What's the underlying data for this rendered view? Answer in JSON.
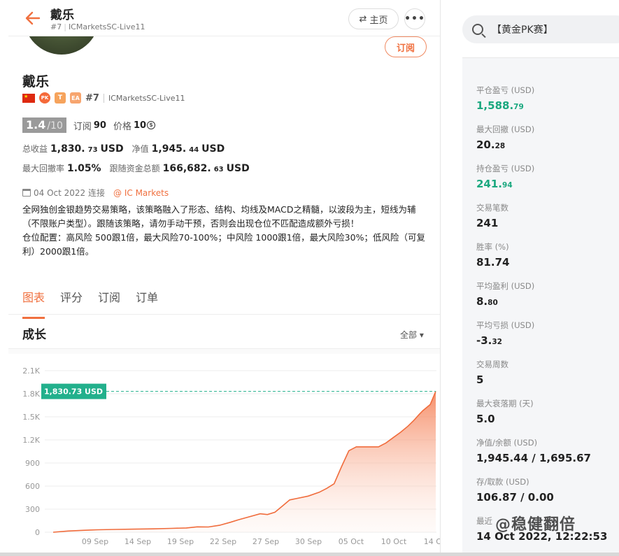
{
  "header": {
    "name": "戴乐",
    "rank": "#7",
    "broker": "ICMarketsSC-Live11",
    "home_label": "主页",
    "more_label": "•••"
  },
  "profile": {
    "name": "戴乐",
    "subscribe_label": "订阅",
    "pk_label": "PK",
    "t_label": "T",
    "ea_label": "EA",
    "rank": "#7",
    "broker": "ICMarketsSC-Live11",
    "score": "1.4",
    "score_total": "/10",
    "subs_label": "订阅",
    "subs_value": "90",
    "price_label": "价格",
    "price_value": "10",
    "price_symbol": "$",
    "total_profit_label": "总收益",
    "total_profit_main": "1,830.",
    "total_profit_dec": "73",
    "equity_label": "净值",
    "equity_main": "1,945.",
    "equity_dec": "44",
    "currency": "USD",
    "max_dd_label": "最大回撤率",
    "max_dd_value": "1.05%",
    "follow_funds_label": "跟随资金总额",
    "follow_funds_main": "166,682.",
    "follow_funds_dec": "63",
    "date_text": "04 Oct 2022 连接",
    "connect_broker": "@ IC Markets",
    "desc_line1": "全网独创金银趋势交易策略，该策略融入了形态、结构、均线及MACD之精髓，以波段为主，短线为辅（不限账户类型）。跟随该策略，请勿手动干预，否则会出现仓位不匹配造成额外亏损！",
    "desc_line2": "仓位配置：高风险 500跟1倍，最大风险70-100%；中风险 1000跟1倍，最大风险30%；低风险（可复利）2000跟1倍。"
  },
  "tabs": [
    "图表",
    "评分",
    "订阅",
    "订单"
  ],
  "growth": {
    "title": "成长",
    "range_label": "全部 ▾"
  },
  "chart_data": {
    "type": "area",
    "x": [
      "09 Sep",
      "14 Sep",
      "19 Sep",
      "22 Sep",
      "27 Sep",
      "30 Sep",
      "05 Oct",
      "10 Oct",
      "14 Oct"
    ],
    "y_ticks": [
      "0",
      "300",
      "600",
      "900",
      "1.2K",
      "1.5K",
      "1.8K",
      "2.1K"
    ],
    "ylim": [
      0,
      2100
    ],
    "marker_label": "1,830.73 USD",
    "marker_value": 1830.73,
    "series": [
      {
        "points": [
          [
            0,
            0
          ],
          [
            0.04,
            15
          ],
          [
            0.08,
            25
          ],
          [
            0.12,
            32
          ],
          [
            0.17,
            36
          ],
          [
            0.22,
            40
          ],
          [
            0.27,
            44
          ],
          [
            0.32,
            50
          ],
          [
            0.36,
            55
          ],
          [
            0.39,
            70
          ],
          [
            0.42,
            68
          ],
          [
            0.45,
            90
          ],
          [
            0.48,
            130
          ],
          [
            0.5,
            160
          ],
          [
            0.53,
            200
          ],
          [
            0.56,
            240
          ],
          [
            0.58,
            230
          ],
          [
            0.6,
            260
          ],
          [
            0.62,
            340
          ],
          [
            0.64,
            420
          ],
          [
            0.66,
            440
          ],
          [
            0.69,
            470
          ],
          [
            0.72,
            520
          ],
          [
            0.74,
            570
          ],
          [
            0.76,
            630
          ],
          [
            0.78,
            850
          ],
          [
            0.8,
            1060
          ],
          [
            0.82,
            1110
          ],
          [
            0.85,
            1110
          ],
          [
            0.88,
            1110
          ],
          [
            0.9,
            1160
          ],
          [
            0.92,
            1230
          ],
          [
            0.94,
            1300
          ],
          [
            0.96,
            1380
          ],
          [
            0.975,
            1450
          ],
          [
            0.99,
            1530
          ],
          [
            1.0,
            1580
          ],
          [
            1.02,
            1660
          ],
          [
            1.035,
            1830.73
          ]
        ]
      }
    ]
  },
  "search": {
    "text": "【黄金PK赛】"
  },
  "stats": [
    {
      "label": "平仓盈亏 (USD)",
      "main": "1,588.",
      "dec": "79",
      "green": true
    },
    {
      "label": "最大回撤 (USD)",
      "main": "20.",
      "dec": "28",
      "green": false
    },
    {
      "label": "持仓盈亏 (USD)",
      "main": "241.",
      "dec": "94",
      "green": true
    },
    {
      "label": "交易笔数",
      "main": "241",
      "dec": "",
      "green": false
    },
    {
      "label": "胜率 (%)",
      "main": "81.74",
      "dec": "",
      "green": false
    },
    {
      "label": "平均盈利 (USD)",
      "main": "8.",
      "dec": "80",
      "green": false
    },
    {
      "label": "平均亏损 (USD)",
      "main": "-3.",
      "dec": "32",
      "green": false
    },
    {
      "label": "交易周数",
      "main": "5",
      "dec": "",
      "green": false
    },
    {
      "label": "最大衰落期 (天)",
      "main": "5.0",
      "dec": "",
      "green": false
    },
    {
      "label": "净值/余额 (USD)",
      "main": "1,945.44 / 1,695.67",
      "dec": "",
      "green": false
    },
    {
      "label": "存/取款 (USD)",
      "main": "106.87 / 0.00",
      "dec": "",
      "green": false
    },
    {
      "label": "最近",
      "main": "14 Oct 2022, 12:22:53",
      "dec": "",
      "green": false
    }
  ],
  "watermark": "@稳健翻倍",
  "colors": {
    "accent": "#f0703f",
    "green": "#1aa87f",
    "marker": "#22b08c"
  }
}
